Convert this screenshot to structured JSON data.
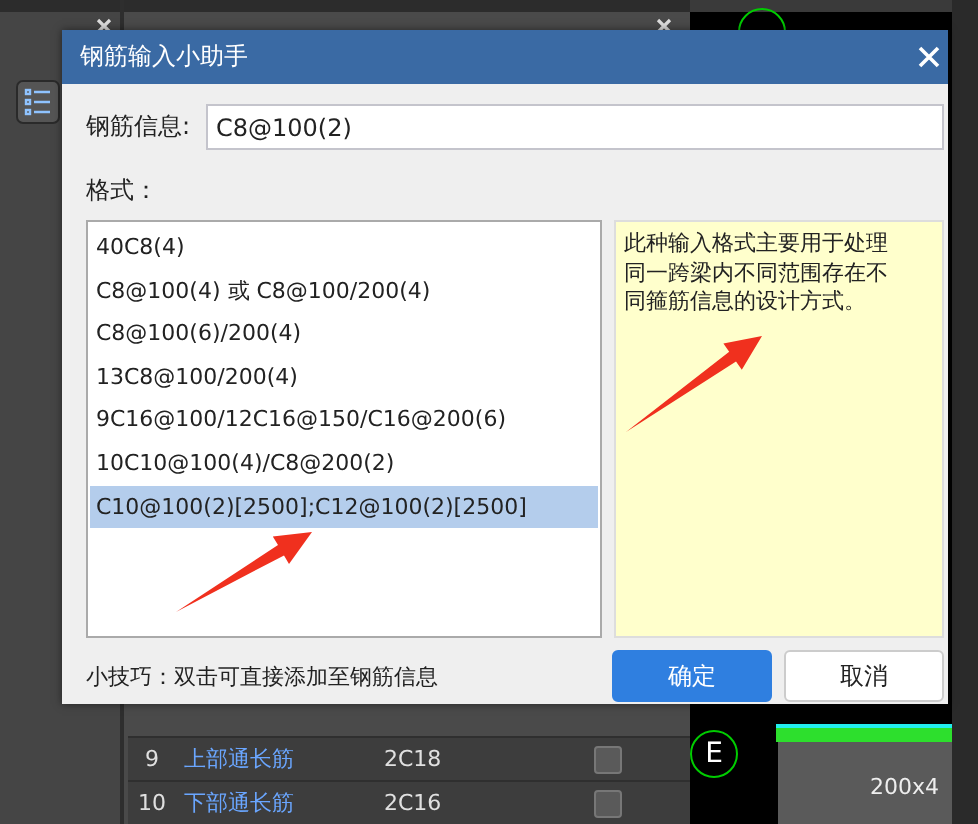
{
  "background": {
    "table_rows": [
      {
        "index": "9",
        "name": "上部通长筋",
        "value": "2C18",
        "checked": false
      },
      {
        "index": "10",
        "name": "下部通长筋",
        "value": "2C16",
        "checked": false
      }
    ],
    "canvas": {
      "axis_label": "E",
      "dimension": "200x4"
    }
  },
  "dialog": {
    "title": "钢筋输入小助手",
    "field": {
      "label": "钢筋信息:",
      "value": "C8@100(2)"
    },
    "format_label": "格式：",
    "formats": [
      {
        "text": "40C8(4)",
        "selected": false
      },
      {
        "text": "C8@100(4) 或 C8@100/200(4)",
        "selected": false
      },
      {
        "text": "C8@100(6)/200(4)",
        "selected": false
      },
      {
        "text": "13C8@100/200(4)",
        "selected": false
      },
      {
        "text": "9C16@100/12C16@150/C16@200(6)",
        "selected": false
      },
      {
        "text": "10C10@100(4)/C8@200(2)",
        "selected": false
      },
      {
        "text": "C10@100(2)[2500];C12@100(2)[2500]",
        "selected": true
      }
    ],
    "description": "此种输入格式主要用于处理同一跨梁内不同范围存在不同箍筋信息的设计方式。",
    "tip": "小技巧：双击可直接添加至钢筋信息",
    "buttons": [
      {
        "label": "确定",
        "kind": "primary"
      },
      {
        "label": "取消",
        "kind": "secondary"
      }
    ]
  }
}
